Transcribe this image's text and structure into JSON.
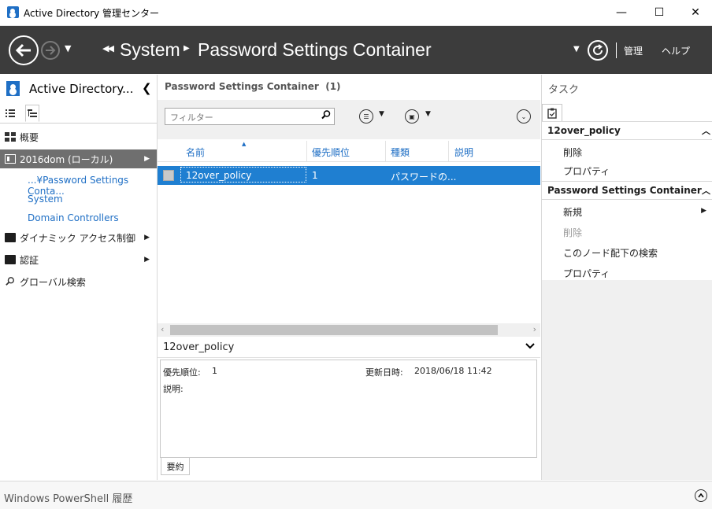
{
  "window": {
    "title": "Active Directory 管理センター",
    "minimize": "—",
    "maximize": "☐",
    "close": "✕"
  },
  "nav": {
    "breadcrumb": [
      "System",
      "Password Settings Container"
    ],
    "manage": "管理",
    "help": "ヘルプ"
  },
  "left_pane": {
    "title": "Active Directory...",
    "items": [
      {
        "label": "概要"
      },
      {
        "label": "2016dom (ローカル)"
      },
      {
        "label": "...¥Password Settings Conta..."
      },
      {
        "label": "System"
      },
      {
        "label": "Domain Controllers"
      },
      {
        "label": "ダイナミック アクセス制御"
      },
      {
        "label": "認証"
      },
      {
        "label": "グローバル検索"
      }
    ]
  },
  "main": {
    "title": "Password Settings Container",
    "count": "(1)",
    "filter_placeholder": "フィルター",
    "columns": [
      "名前",
      "優先順位",
      "種類",
      "説明"
    ],
    "rows": [
      {
        "name": "12over_policy",
        "precedence": "1",
        "type": "パスワードの...",
        "description": ""
      }
    ]
  },
  "details": {
    "title": "12over_policy",
    "precedence_label": "優先順位:",
    "precedence_value": "1",
    "modified_label": "更新日時:",
    "modified_value": "2018/06/18 11:42",
    "description_label": "説明:",
    "summary_tab": "要約"
  },
  "tasks": {
    "title": "タスク",
    "sections": [
      {
        "title": "12over_policy",
        "items": [
          "削除",
          "プロパティ"
        ]
      },
      {
        "title": "Password Settings Container",
        "items": [
          "新規",
          "削除",
          "このノード配下の検索",
          "プロパティ"
        ]
      }
    ]
  },
  "status": {
    "powershell": "Windows PowerShell 履歴"
  },
  "colors": {
    "nav_bg": "#3c3c3c",
    "selection": "#1f7fd1",
    "accent": "#1f6fc5"
  }
}
